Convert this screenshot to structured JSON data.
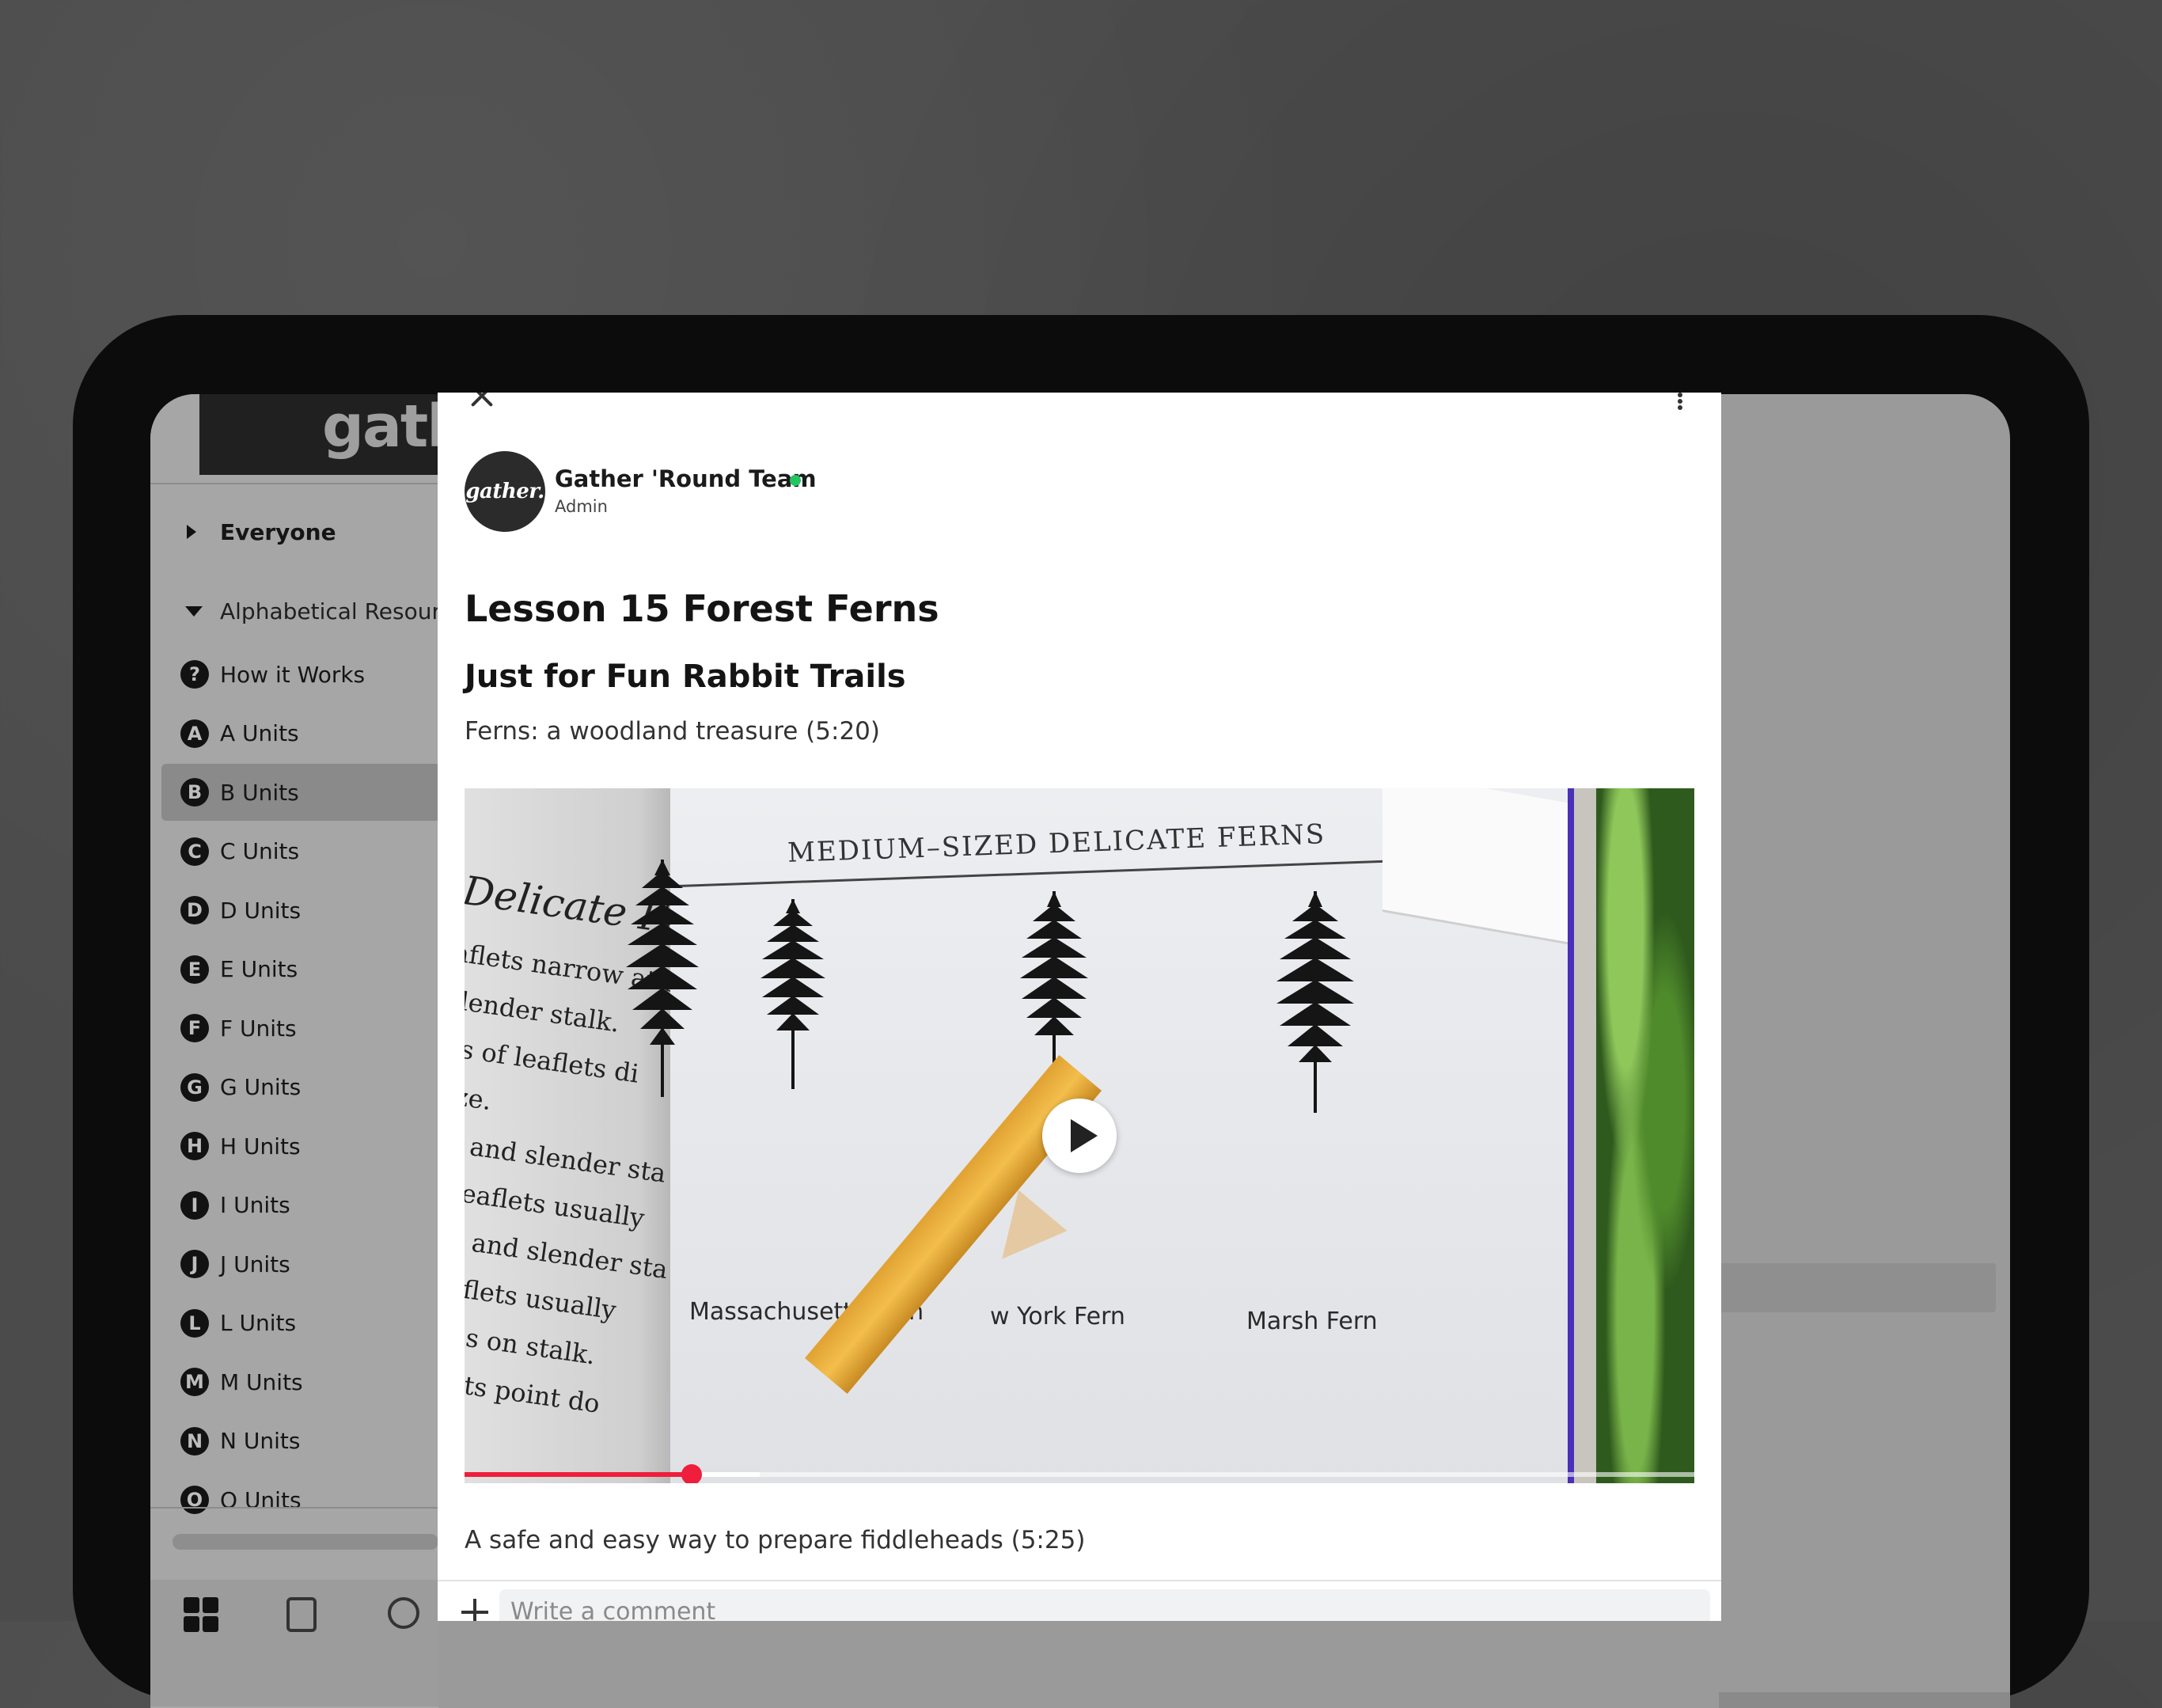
{
  "sidebar": {
    "logo_text": "gath",
    "everyone_label": "Everyone",
    "section_label": "Alphabetical Resourc",
    "items": [
      {
        "badge": "?",
        "label": "How it Works"
      },
      {
        "badge": "A",
        "label": "A Units"
      },
      {
        "badge": "B",
        "label": "B Units",
        "selected": true
      },
      {
        "badge": "C",
        "label": "C Units"
      },
      {
        "badge": "D",
        "label": "D Units"
      },
      {
        "badge": "E",
        "label": "E Units"
      },
      {
        "badge": "F",
        "label": "F Units"
      },
      {
        "badge": "G",
        "label": "G Units"
      },
      {
        "badge": "H",
        "label": "H Units"
      },
      {
        "badge": "I",
        "label": "I Units"
      },
      {
        "badge": "J",
        "label": "J Units"
      },
      {
        "badge": "L",
        "label": "L Units"
      },
      {
        "badge": "M",
        "label": "M Units"
      },
      {
        "badge": "N",
        "label": "N Units"
      },
      {
        "badge": "O",
        "label": "O Units"
      }
    ]
  },
  "post": {
    "author": {
      "avatar_text": "gather.",
      "name": "Gather 'Round Team",
      "role": "Admin",
      "online": true
    },
    "title": "Lesson 15 Forest Ferns",
    "subtitle": "Just for Fun Rabbit Trails",
    "caption_1": "Ferns: a woodland treasure (5:20)",
    "caption_2": "A safe and easy way to prepare fiddleheads (5:25)",
    "video": {
      "page_header": "MEDIUM–SIZED  DELICATE  FERNS",
      "left_page_heading": "Delicate Ferns",
      "left_page_lines": [
        "aflets narrow at axis",
        "slender stalk.",
        "irs  of  leaflets  di",
        "size.",
        "th, and slender sta",
        " of leaflets usually",
        "oth, and slender sta",
        "f leaflets usually",
        "scales on stalk.",
        "leaflets point do"
      ],
      "fern_labels": [
        "Massachusetts Fern",
        "w York Fern",
        "Marsh Fern"
      ],
      "progress_played": 0.185,
      "progress_buffered": 0.24
    },
    "comment": {
      "placeholder": "Write a comment"
    }
  },
  "colors": {
    "online": "#22c55e",
    "progress": "#ef1e3c"
  }
}
